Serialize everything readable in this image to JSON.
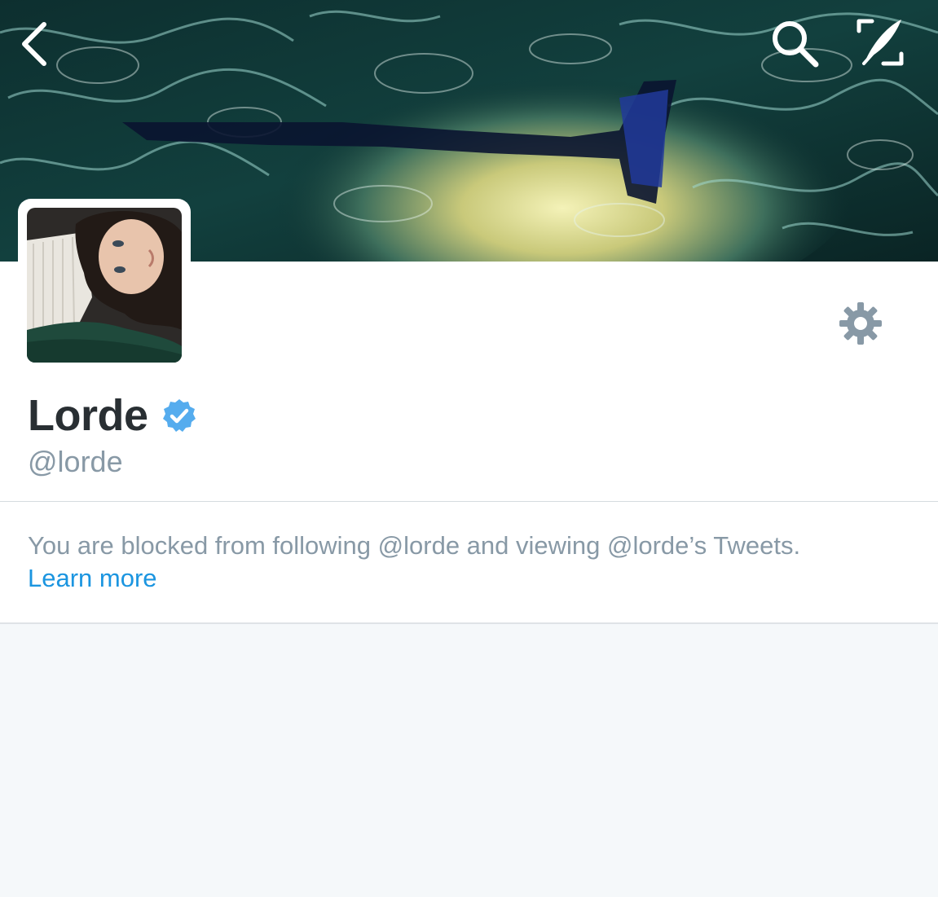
{
  "header": {
    "back_icon": "chevron-left-icon",
    "search_icon": "search-icon",
    "compose_icon": "compose-tweet-icon",
    "icon_color": "#ffffff"
  },
  "profile": {
    "display_name": "Lorde",
    "verified": true,
    "verified_badge_color": "#1da1f2",
    "handle": "@lorde",
    "settings_icon": "gear-icon",
    "settings_icon_color": "#8899a6"
  },
  "notice": {
    "text": "You are blocked from following @lorde and viewing @lorde’s Tweets.",
    "link_label": "Learn more",
    "link_color": "#1b95e0",
    "text_color": "#8899a6"
  },
  "colors": {
    "name_text": "#292f33",
    "page_background": "#f5f8fa",
    "card_background": "#ffffff"
  }
}
